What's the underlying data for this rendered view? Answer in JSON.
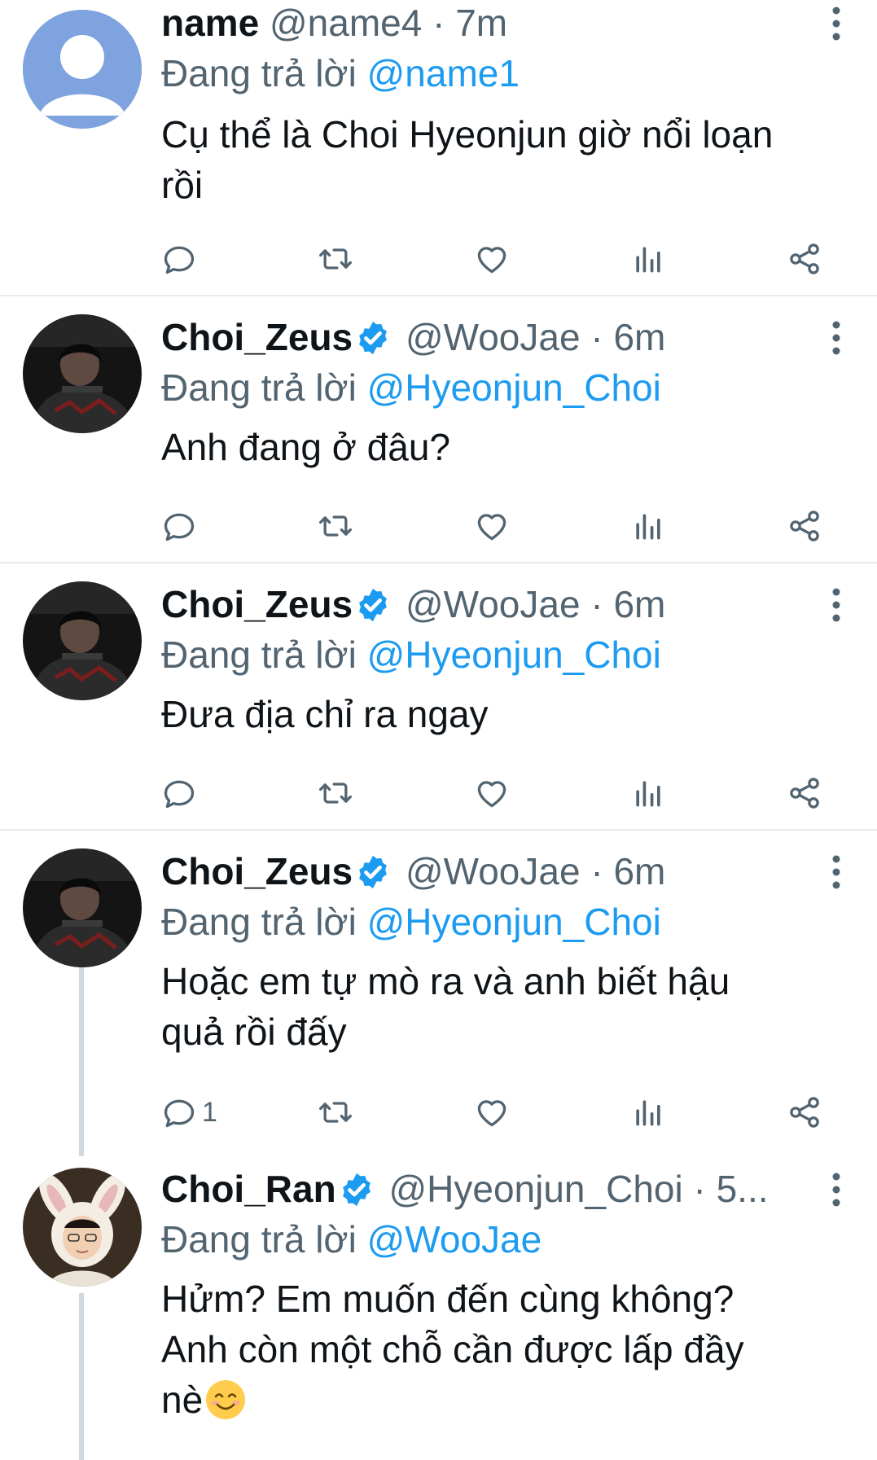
{
  "tweets": [
    {
      "display_name": "name",
      "handle": "@name4",
      "time": "· 7m",
      "verified": false,
      "reply_prefix": "Đang trả lời",
      "reply_to": "@name1",
      "text": "Cụ thể là Choi Hyeonjun giờ nổi loạn\nrồi",
      "reply_count": "",
      "avatar_icon": "default-user-icon"
    },
    {
      "display_name": "Choi_Zeus",
      "handle": "@WooJae",
      "time": "· 6m",
      "verified": true,
      "reply_prefix": "Đang trả lời",
      "reply_to": "@Hyeonjun_Choi",
      "text": "Anh đang ở đâu?",
      "reply_count": "",
      "avatar_icon": "user-photo-dark"
    },
    {
      "display_name": "Choi_Zeus",
      "handle": "@WooJae",
      "time": "· 6m",
      "verified": true,
      "reply_prefix": "Đang trả lời",
      "reply_to": "@Hyeonjun_Choi",
      "text": "Đưa địa chỉ ra ngay",
      "reply_count": "",
      "avatar_icon": "user-photo-dark"
    },
    {
      "display_name": "Choi_Zeus",
      "handle": "@WooJae",
      "time": "· 6m",
      "verified": true,
      "reply_prefix": "Đang trả lời",
      "reply_to": "@Hyeonjun_Choi",
      "text": "Hoặc em tự mò ra và anh biết hậu\nquả rồi đấy",
      "reply_count": "1",
      "avatar_icon": "user-photo-dark"
    },
    {
      "display_name": "Choi_Ran",
      "handle": "@Hyeonjun_Choi",
      "time": "· 5...",
      "verified": true,
      "reply_prefix": "Đang trả lời",
      "reply_to": "@WooJae",
      "text": "Hửm? Em muốn đến cùng không?\nAnh còn một chỗ cần được lấp đầy\nnè",
      "reply_count": "",
      "avatar_icon": "user-photo-bunny-ears",
      "trailing_emoji": "smiling-face-emoji"
    }
  ],
  "colors": {
    "accent": "#1d9bf0",
    "secondary_text": "#536471",
    "divider": "#e6ecf0",
    "thread_line": "#cfd9de"
  },
  "icons": {
    "reply": "reply-icon",
    "retweet": "retweet-icon",
    "like": "heart-icon",
    "views": "analytics-icon",
    "share": "share-icon",
    "more": "more-options-icon",
    "verified": "verified-badge-icon"
  }
}
